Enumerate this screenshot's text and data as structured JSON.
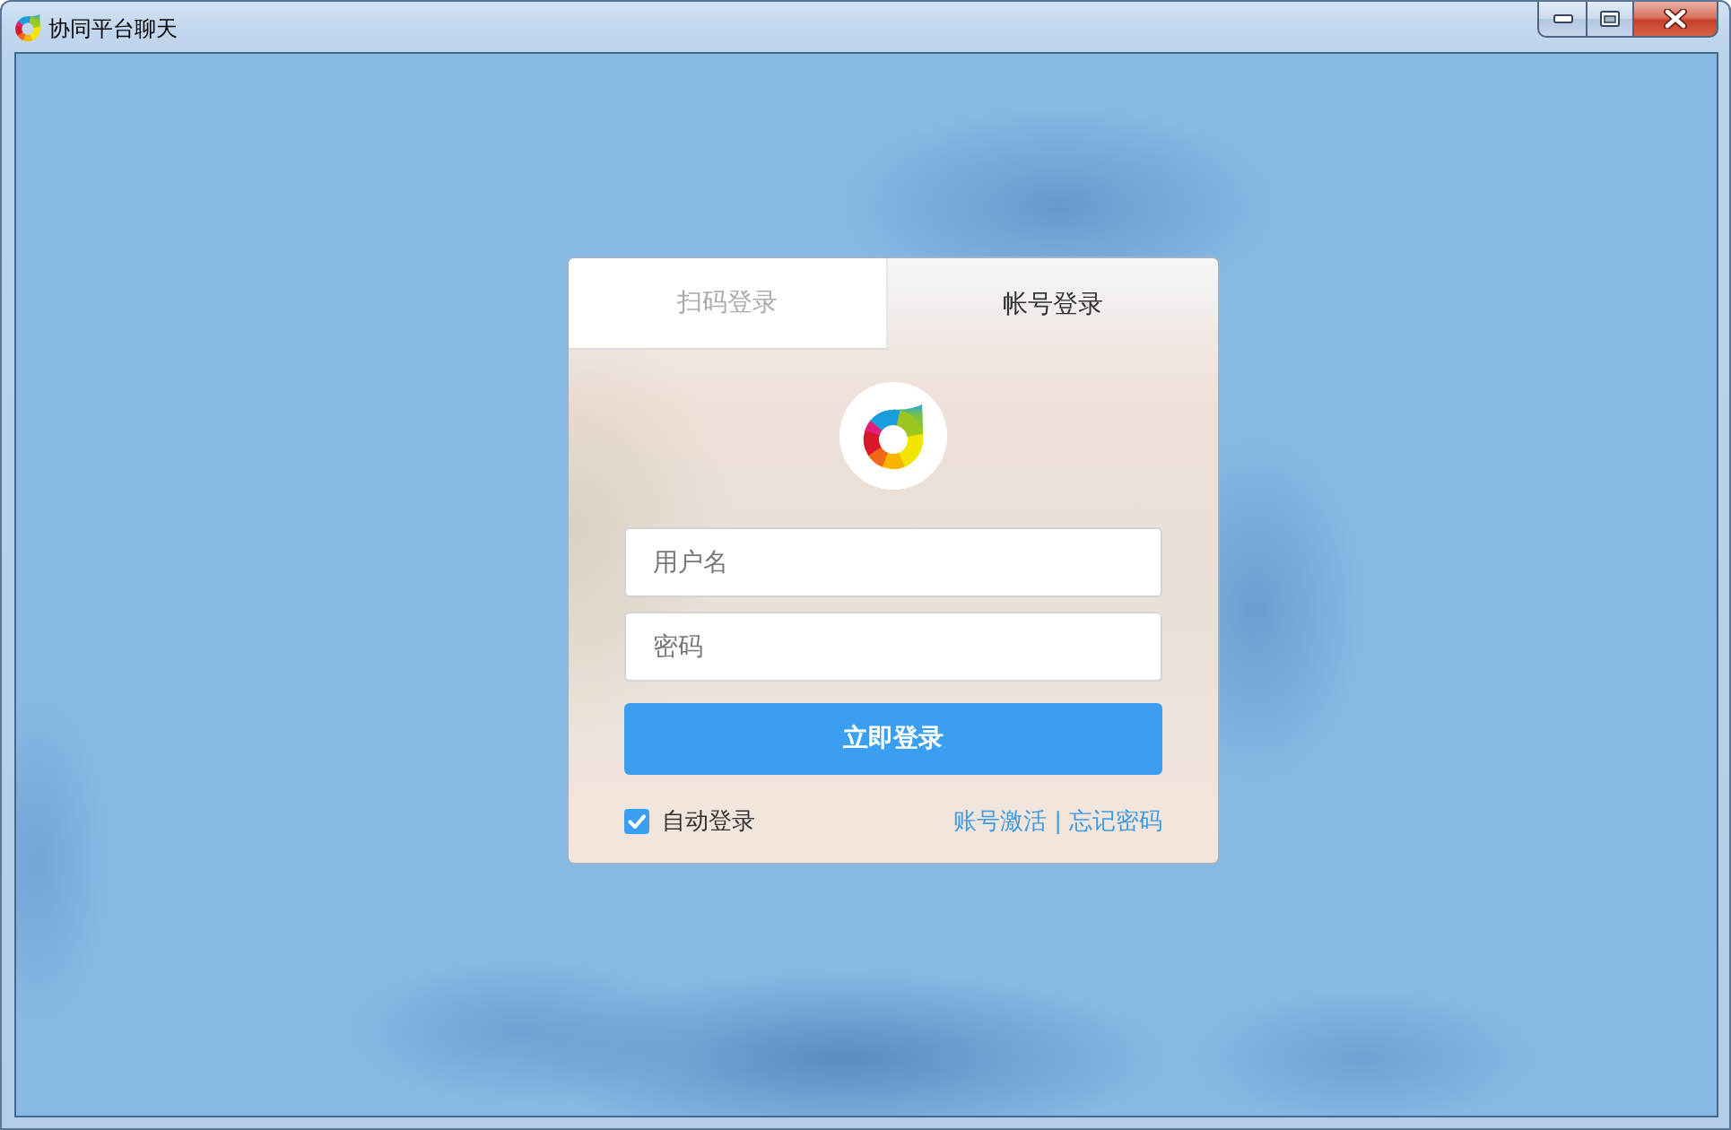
{
  "window": {
    "title": "协同平台聊天"
  },
  "login": {
    "tabs": [
      {
        "label": "扫码登录",
        "selected": false
      },
      {
        "label": "帐号登录",
        "selected": true
      }
    ],
    "fields": [
      {
        "placeholder": "用户名"
      },
      {
        "placeholder": "密码"
      }
    ],
    "submit_button": "立即登录",
    "auto_login": {
      "label": "自动登录",
      "checked": true
    },
    "links": [
      "账号激活",
      "忘记密码"
    ],
    "link_separator": "|"
  }
}
